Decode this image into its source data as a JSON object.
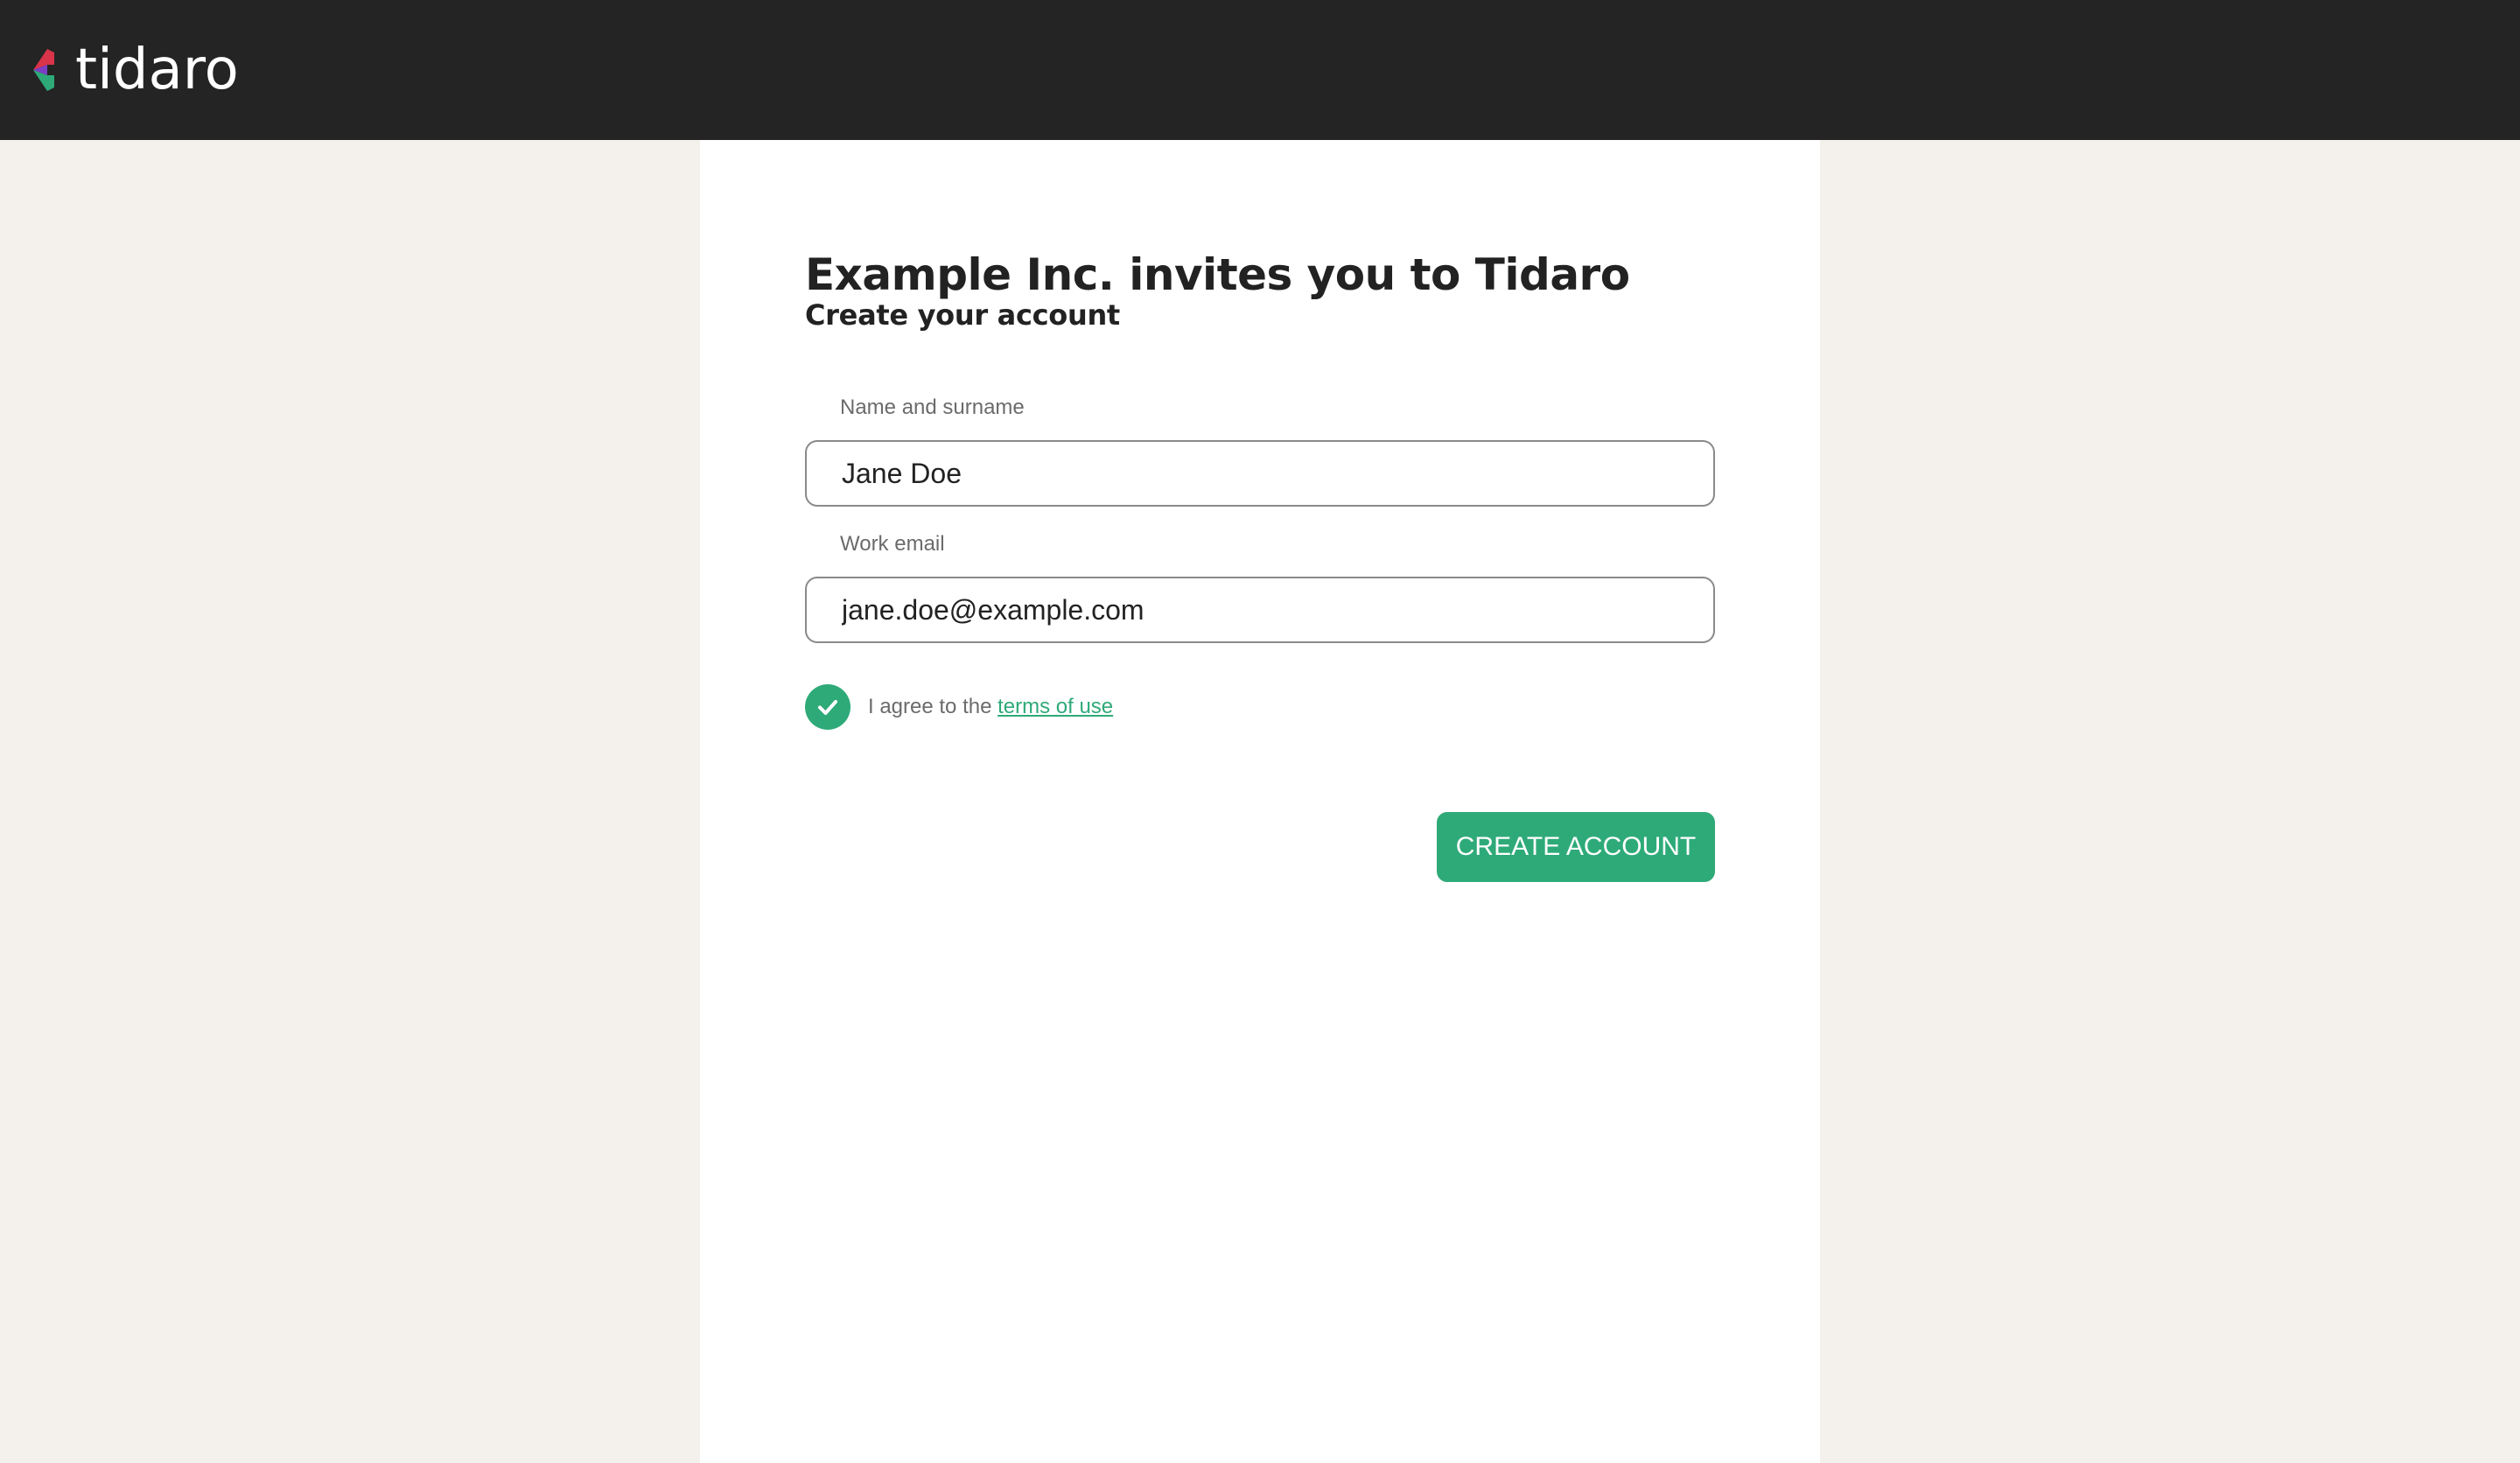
{
  "brand": {
    "name": "tidaro",
    "colors": {
      "topbar": "#242424",
      "accent": "#2eaa78",
      "logo_purple": "#7b3fc4",
      "logo_red": "#d9344a",
      "logo_green": "#2eaa78"
    }
  },
  "form": {
    "heading": "Example Inc. invites you to Tidaro",
    "subheading": "Create your account",
    "name_field": {
      "label": "Name and surname",
      "value": "Jane Doe"
    },
    "email_field": {
      "label": "Work email",
      "value": "jane.doe@example.com"
    },
    "terms": {
      "checked": true,
      "prefix": "I agree to the ",
      "link_text": "terms of use"
    },
    "submit_label": "CREATE ACCOUNT"
  },
  "icons": {
    "logo": "tidaro-logo-icon",
    "checkbox": "checkmark-icon"
  }
}
